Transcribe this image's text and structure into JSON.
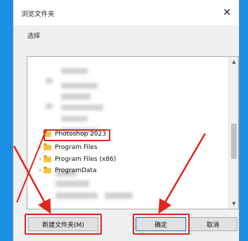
{
  "dialog": {
    "title": "浏览文件夹",
    "close_glyph": "✕",
    "prompt": "选择"
  },
  "tree": {
    "items": [
      {
        "label": "Photoshop 2023",
        "selected": true,
        "expandable": false
      },
      {
        "label": "Program Files",
        "selected": false,
        "expandable": true
      },
      {
        "label": "Program Files (x86)",
        "selected": false,
        "expandable": true
      },
      {
        "label": "ProgramData",
        "selected": false,
        "expandable": true
      }
    ],
    "expand_glyph": "›",
    "scroll_up_glyph": "▲",
    "scroll_down_glyph": "▼"
  },
  "buttons": {
    "new_folder": "新建文件夹(M)",
    "ok": "确定",
    "cancel": "取消"
  },
  "colors": {
    "annotation_red": "#e0261d",
    "desktop_blue": "#1a8fe3",
    "folder_yellow": "#f5c542"
  },
  "icons": [
    "close-icon",
    "folder-icon",
    "chevron-right-icon",
    "scroll-up-icon",
    "scroll-down-icon"
  ]
}
